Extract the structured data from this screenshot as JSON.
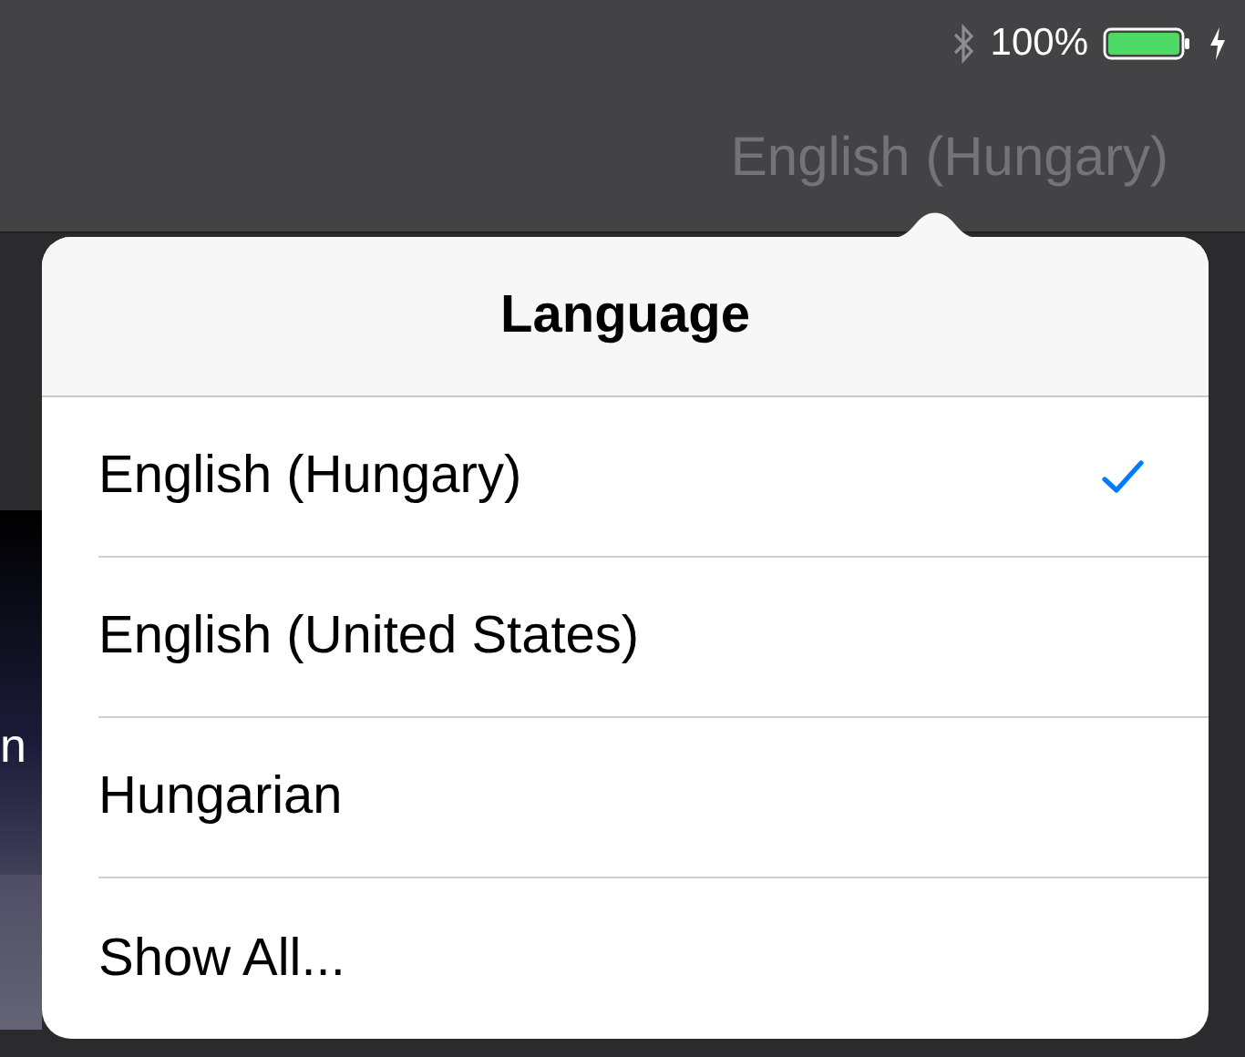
{
  "status_bar": {
    "battery": "100%"
  },
  "toolbar": {
    "language_button": "English (Hungary)"
  },
  "background": {
    "text_fragment": "n"
  },
  "popover": {
    "title": "Language",
    "items": [
      {
        "label": "English (Hungary)",
        "selected": true
      },
      {
        "label": "English (United States)",
        "selected": false
      },
      {
        "label": "Hungarian",
        "selected": false
      },
      {
        "label": "Show All...",
        "selected": false
      }
    ]
  }
}
